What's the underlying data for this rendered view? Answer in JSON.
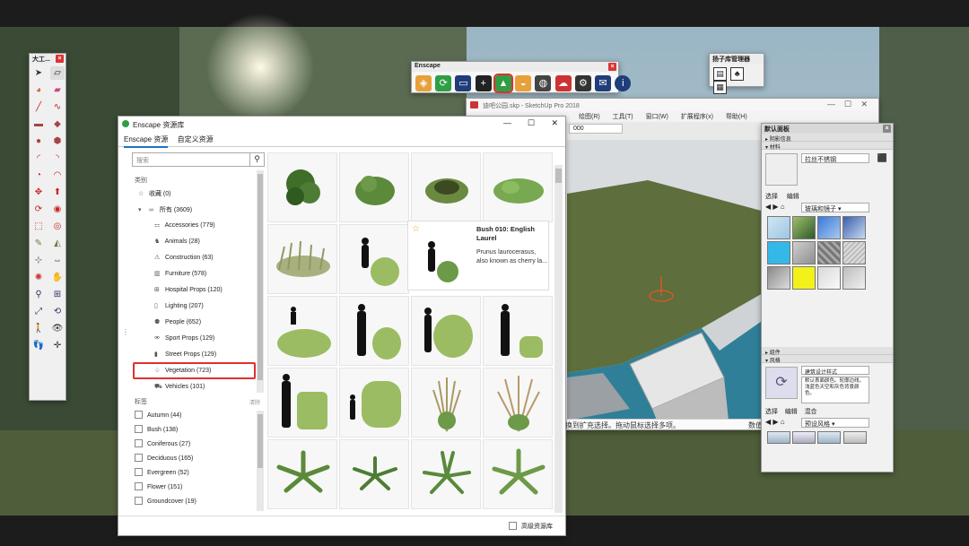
{
  "left_toolbar": {
    "title": "大工..."
  },
  "enscape_toolbar": {
    "title": "Enscape"
  },
  "asset_toolbar": {
    "title": "扬子库管理器"
  },
  "sketchup": {
    "title": "迪吧公园.skp - SketchUp Pro 2018",
    "menus": [
      "绘图(R)",
      "工具(T)",
      "窗口(W)",
      "扩展程序(x)",
      "帮助(H)"
    ],
    "scene_field": "000",
    "status_text": "换到扩充选择。拖动鼠标选择多项。",
    "status_right": "数值"
  },
  "tray": {
    "title": "默认面板",
    "sec_shadow": "阴影信息",
    "sec_material": "材料",
    "material_name": "拉丝不锈钢",
    "tab_select": "选择",
    "tab_edit": "编辑",
    "material_dropdown": "玻璃和镜子",
    "sec_component": "组件",
    "sec_style": "风格",
    "style_name": "建筑设计样式",
    "style_desc": "默认表面颜色。轮廓边线。浅蓝色天空和灰色背景颜色。",
    "style_tabs": [
      "选择",
      "编辑",
      "混合"
    ],
    "style_dropdown": "预设风格"
  },
  "enscape_library": {
    "title": "Enscape 资源库",
    "tabs": [
      "Enscape 资源",
      "自定义资源"
    ],
    "search_placeholder": "搜索",
    "category_header": "类别",
    "favorites": "收藏 (0)",
    "all": "所有 (3609)",
    "categories": [
      {
        "label": "Accessories (779)",
        "icon": "accessories-icon"
      },
      {
        "label": "Animals (28)",
        "icon": "animals-icon"
      },
      {
        "label": "Construction (63)",
        "icon": "construction-icon"
      },
      {
        "label": "Furniture (578)",
        "icon": "furniture-icon"
      },
      {
        "label": "Hospital Props (120)",
        "icon": "hospital-icon"
      },
      {
        "label": "Lighting (207)",
        "icon": "lighting-icon"
      },
      {
        "label": "People (652)",
        "icon": "people-icon"
      },
      {
        "label": "Sport Props (129)",
        "icon": "sport-icon"
      },
      {
        "label": "Street Props (129)",
        "icon": "street-icon"
      },
      {
        "label": "Vegetation (723)",
        "icon": "vegetation-icon"
      },
      {
        "label": "Vehicles (101)",
        "icon": "vehicles-icon"
      }
    ],
    "tags_header": "标签",
    "tags_clear": "清除",
    "tags": [
      "Autumn (44)",
      "Bush (138)",
      "Coniferous (27)",
      "Deciduous (165)",
      "Evergreen (52)",
      "Flower (151)",
      "Groundcover (19)"
    ],
    "detail": {
      "title": "Bush 010: English Laurel",
      "desc": "Prunus laurocerasus, also known as cherry la..."
    },
    "footer_checkbox": "高级资源库"
  },
  "colors": {
    "accent": "#1a73c8",
    "highlight": "#e03030"
  }
}
